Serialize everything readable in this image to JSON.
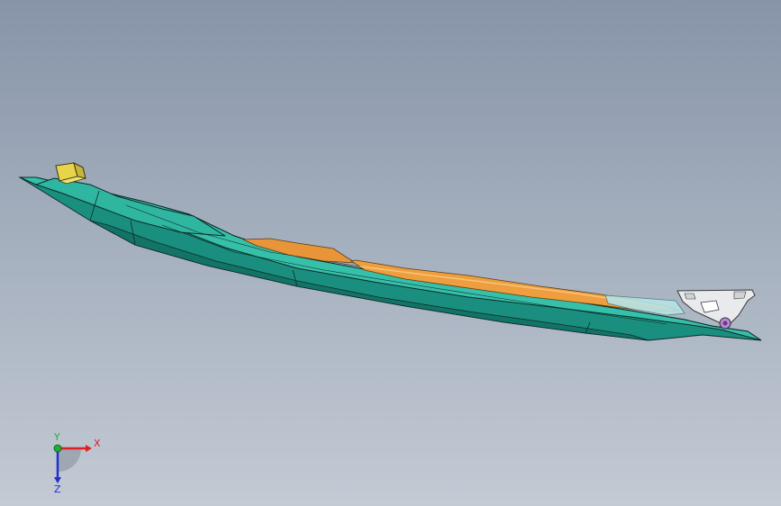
{
  "viewport": {
    "background_top": "#8794a8",
    "background_bottom": "#c3cad4"
  },
  "model": {
    "colors": {
      "body": "#1e9e8c",
      "body_light": "#3cc4b0",
      "body_dark": "#0f6f62",
      "interior": "#e89a3c",
      "interior_light": "#f2b865",
      "glass": "#a9dde0",
      "bracket": "#e6e8ea",
      "clip": "#e8d44a",
      "edge": "#0d2a27"
    },
    "parts": [
      "bracket-icon",
      "clip-icon",
      "grommet-icon"
    ]
  },
  "triad": {
    "x_label": "X",
    "y_label": "Y",
    "z_label": "Z",
    "x_color": "#e02020",
    "y_color": "#20b030",
    "z_color": "#2030d0"
  }
}
